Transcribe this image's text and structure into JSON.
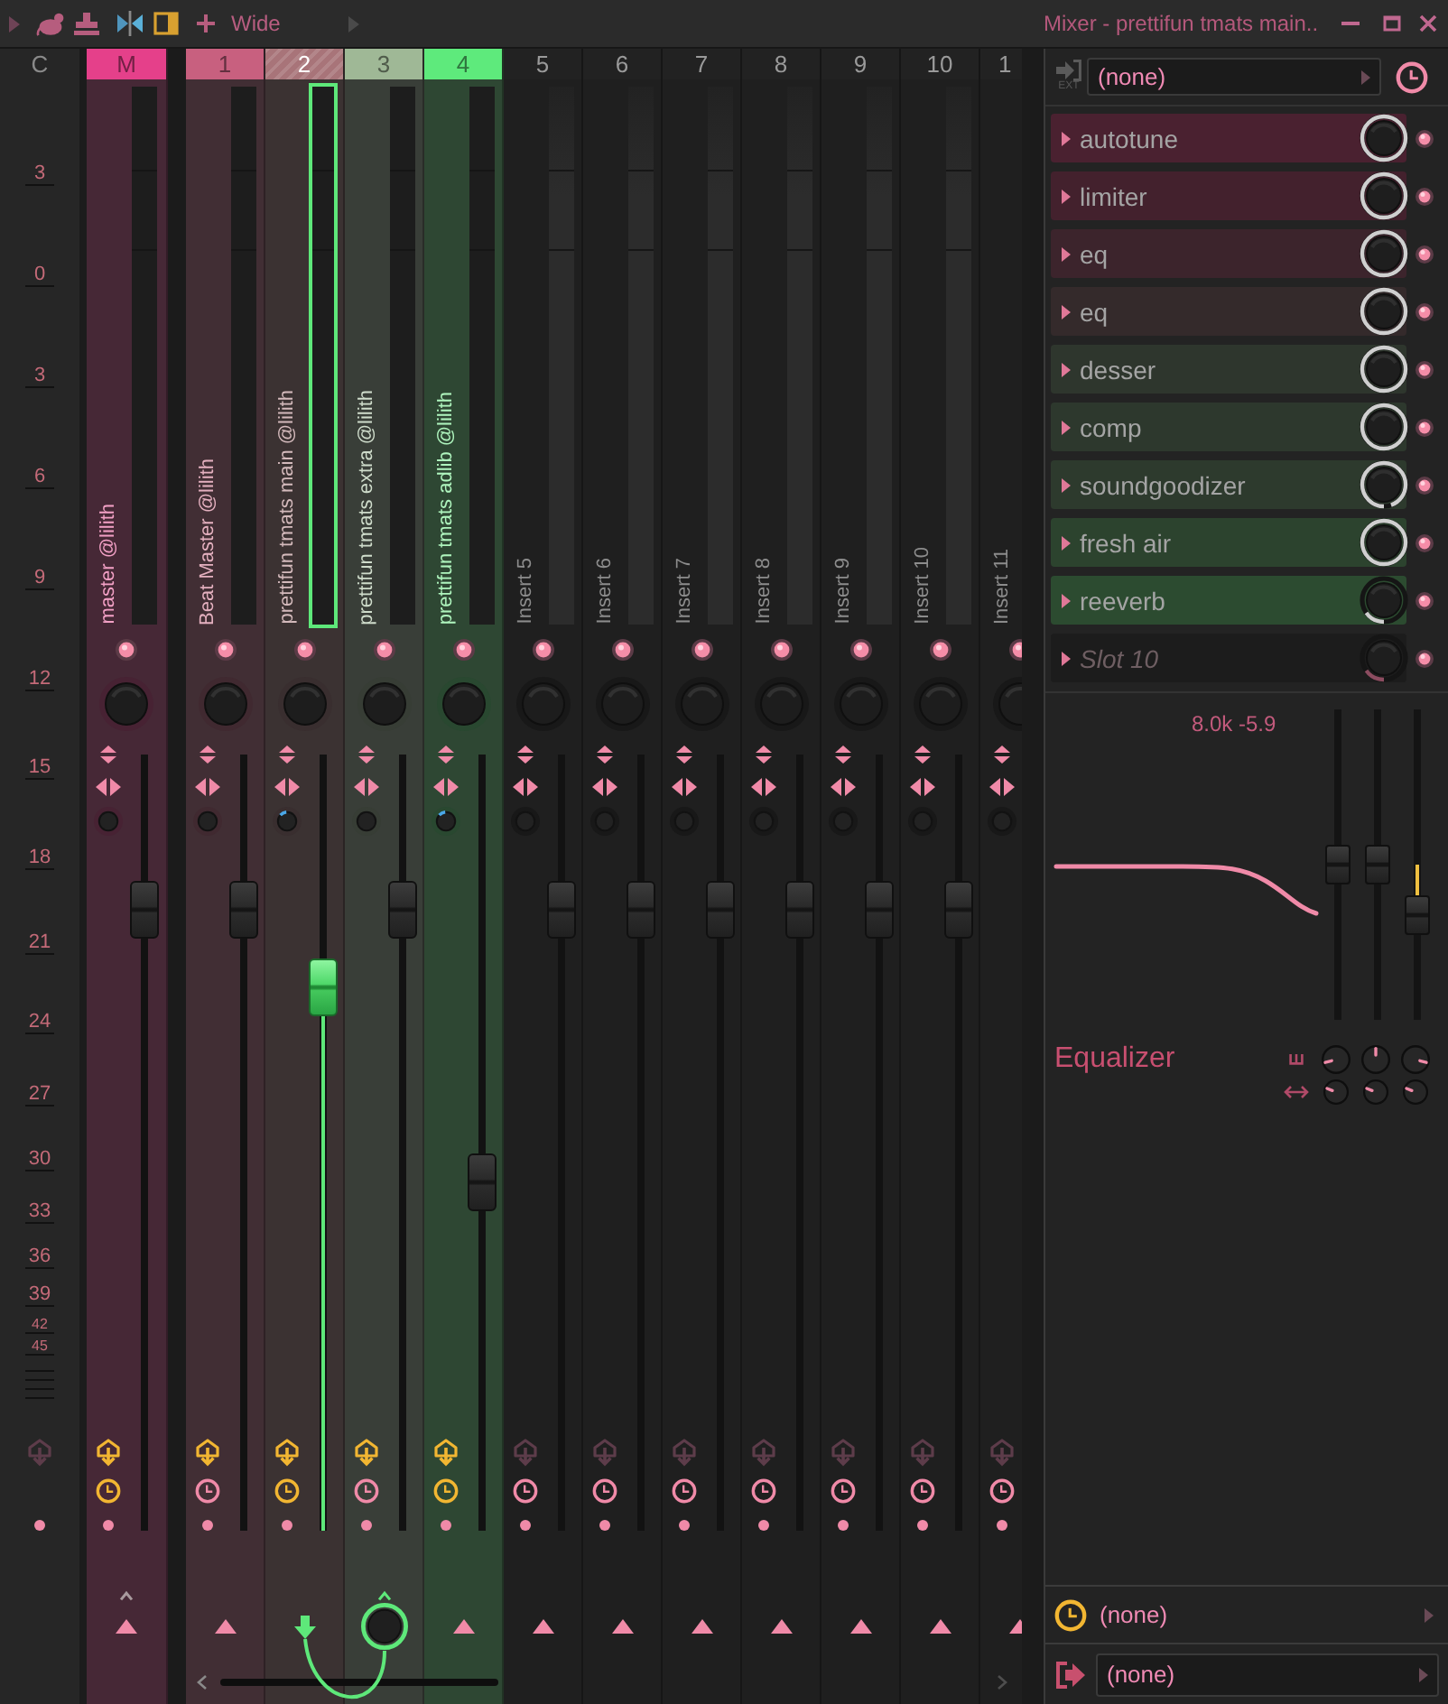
{
  "toolbar": {
    "label": "Wide"
  },
  "window": {
    "title": "Mixer - prettifun tmats main.."
  },
  "scale": {
    "header": "C",
    "meter_ticks": [
      "3",
      "0",
      "3",
      "6",
      "9",
      "12"
    ],
    "fader_ticks": [
      "15",
      "18",
      "21",
      "24",
      "27",
      "30",
      "33",
      "36",
      "39",
      "42",
      "45"
    ],
    "armed": false
  },
  "tracks": [
    {
      "kind": "master",
      "header": "M",
      "name": "master @lilith",
      "color": "#e5408a",
      "selected": false,
      "enabled": true,
      "level": 0.8,
      "stereo_marked": false,
      "armed": true,
      "clock_on": true,
      "caret": {
        "kind": "dim"
      },
      "send": {
        "kind": "triangle"
      }
    },
    {
      "kind": "insert",
      "header": "1",
      "name": "Beat Master @lilith",
      "color": "#c8607f",
      "selected": false,
      "enabled": true,
      "level": 0.8,
      "stereo_marked": false,
      "armed": true,
      "clock_on": false,
      "send": {
        "kind": "triangle"
      }
    },
    {
      "kind": "insert",
      "header": "2",
      "name": "prettifun tmats main @lilith",
      "color": "#a87479",
      "selected": true,
      "enabled": true,
      "level": 0.7,
      "stereo_marked": true,
      "armed": true,
      "clock_on": true,
      "send": {
        "kind": "arrow"
      }
    },
    {
      "kind": "insert",
      "header": "3",
      "name": "prettifun tmats extra @lilith",
      "color": "#9fb896",
      "selected": false,
      "enabled": true,
      "level": 0.8,
      "stereo_marked": false,
      "armed": true,
      "clock_on": false,
      "caret": {
        "kind": "lit"
      },
      "send": {
        "kind": "knob"
      }
    },
    {
      "kind": "insert",
      "header": "4",
      "name": "prettifun tmats adlib @lilith",
      "color": "#5eea7c",
      "selected": false,
      "enabled": true,
      "level": 0.45,
      "stereo_marked": true,
      "armed": true,
      "clock_on": true,
      "send": {
        "kind": "triangle"
      }
    },
    {
      "kind": "insert",
      "header": "5",
      "name": "Insert 5",
      "selected": false,
      "enabled": true,
      "level": 0.8,
      "stereo_marked": false,
      "armed": false,
      "clock_on": false,
      "send": {
        "kind": "triangle"
      }
    },
    {
      "kind": "insert",
      "header": "6",
      "name": "Insert 6",
      "selected": false,
      "enabled": true,
      "level": 0.8,
      "stereo_marked": false,
      "armed": false,
      "clock_on": false,
      "send": {
        "kind": "triangle"
      }
    },
    {
      "kind": "insert",
      "header": "7",
      "name": "Insert 7",
      "selected": false,
      "enabled": true,
      "level": 0.8,
      "stereo_marked": false,
      "armed": false,
      "clock_on": false,
      "send": {
        "kind": "triangle"
      }
    },
    {
      "kind": "insert",
      "header": "8",
      "name": "Insert 8",
      "selected": false,
      "enabled": true,
      "level": 0.8,
      "stereo_marked": false,
      "armed": false,
      "clock_on": false,
      "send": {
        "kind": "triangle"
      }
    },
    {
      "kind": "insert",
      "header": "9",
      "name": "Insert 9",
      "selected": false,
      "enabled": true,
      "level": 0.8,
      "stereo_marked": false,
      "armed": false,
      "clock_on": false,
      "send": {
        "kind": "triangle"
      }
    },
    {
      "kind": "insert",
      "header": "10",
      "name": "Insert 10",
      "selected": false,
      "enabled": true,
      "level": 0.8,
      "stereo_marked": false,
      "armed": false,
      "clock_on": false,
      "send": {
        "kind": "triangle"
      }
    },
    {
      "kind": "insert",
      "header": "1",
      "name": "Insert 11",
      "selected": false,
      "enabled": true,
      "stereo_marked": false,
      "armed": false,
      "clock_on": false,
      "send": {
        "kind": "triangle"
      }
    }
  ],
  "inspector": {
    "ext_label": "EXT",
    "input": "(none)",
    "slots": [
      {
        "name": "autotune",
        "color": "#4a2130",
        "empty": false,
        "level": 1,
        "enabled": true
      },
      {
        "name": "limiter",
        "color": "#43212d",
        "empty": false,
        "level": 1,
        "enabled": true
      },
      {
        "name": "eq",
        "color": "#3c242c",
        "empty": false,
        "level": 1,
        "enabled": true
      },
      {
        "name": "eq",
        "color": "#342a2b",
        "empty": false,
        "level": 1,
        "enabled": true
      },
      {
        "name": "desser",
        "color": "#2e362d",
        "empty": false,
        "level": 1,
        "enabled": true
      },
      {
        "name": "comp",
        "color": "#2d382d",
        "empty": false,
        "level": 1,
        "enabled": true
      },
      {
        "name": "soundgoodizer",
        "color": "#2d3a2d",
        "empty": false,
        "level": 0.94,
        "enabled": true
      },
      {
        "name": "fresh air",
        "color": "#2c432e",
        "empty": false,
        "level": 1,
        "enabled": true
      },
      {
        "name": "reeverb",
        "color": "#2c4b30",
        "empty": false,
        "level": 0.15,
        "enabled": true
      },
      {
        "name": "Slot 10",
        "color": "#1c1c1c",
        "empty": true,
        "level": 0.15,
        "enabled": true
      }
    ],
    "eq": {
      "readout": "8.0k -5.9",
      "bands": [
        {
          "level": 0.5
        },
        {
          "level": 0.5
        },
        {
          "level": 0.34
        }
      ],
      "title": "Equalizer",
      "freq_knobs": [
        {
          "kind": "low"
        },
        {
          "kind": "center"
        },
        {
          "kind": "high"
        }
      ],
      "width_knobs": [
        {
          "kind": "narrow"
        },
        {
          "kind": "narrow"
        },
        {
          "kind": "narrow"
        }
      ]
    },
    "time": "(none)",
    "output": "(none)"
  }
}
